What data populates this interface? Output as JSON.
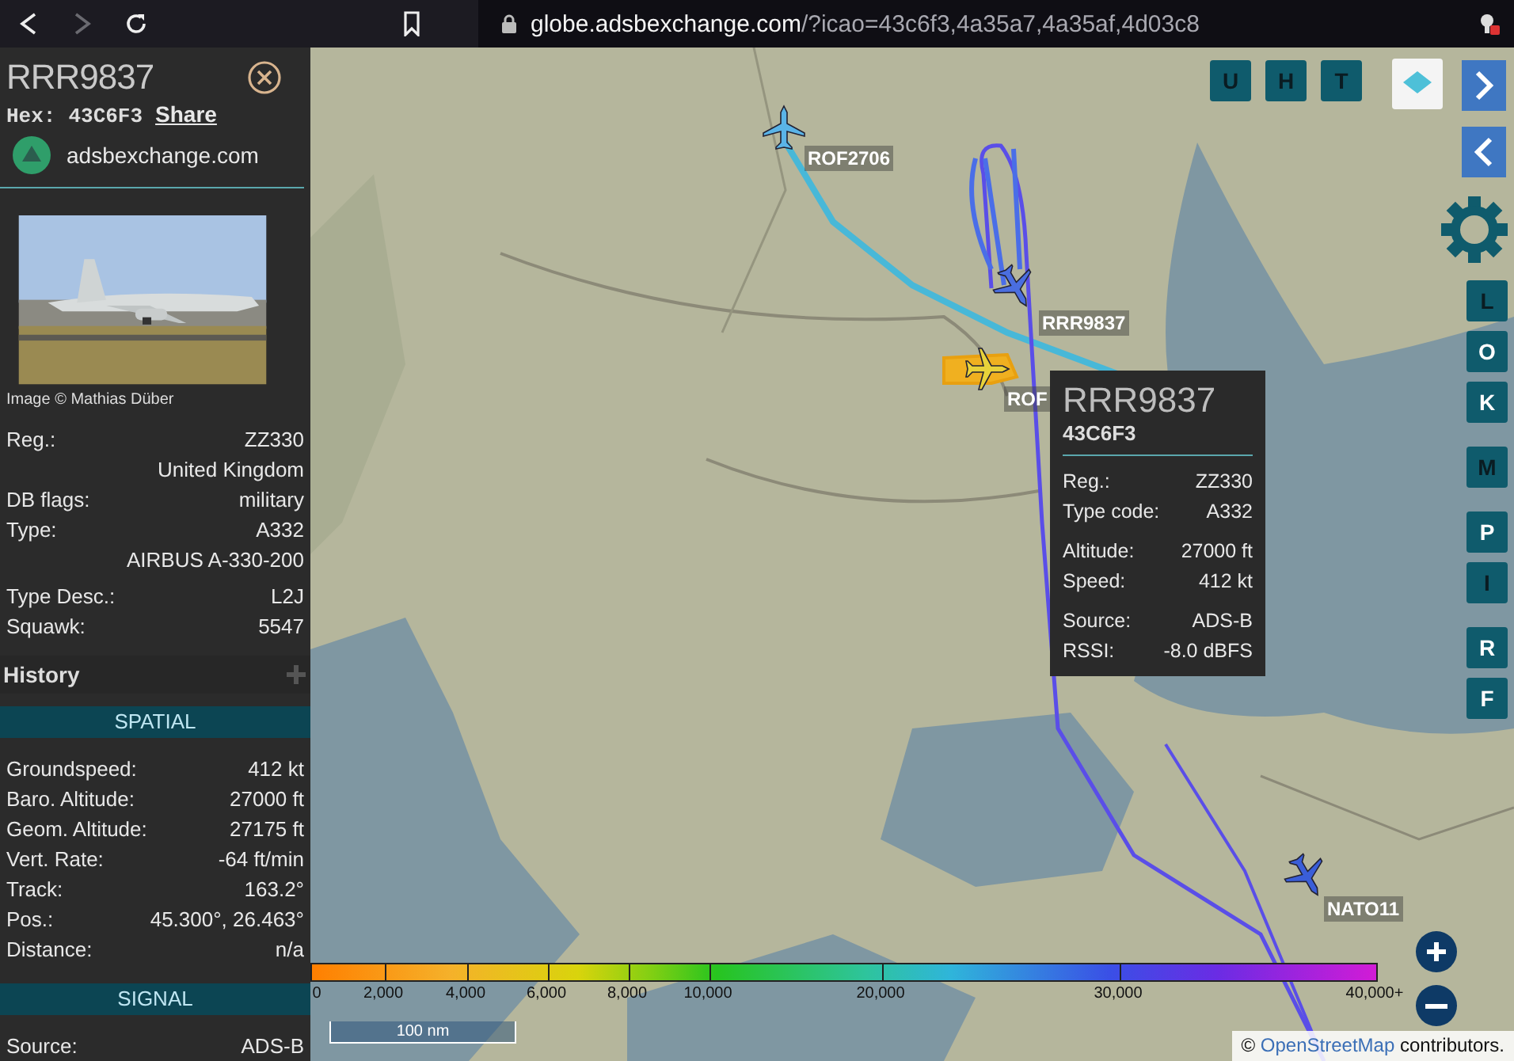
{
  "browser": {
    "url_host": "globe.adsbexchange.com",
    "url_path": "/?icao=43c6f3,4a35a7,4a35af,4d03c8",
    "forward_disabled": true
  },
  "sidebar": {
    "callsign": "RRR9837",
    "hex_label": "Hex:",
    "hex": "43C6F3",
    "share": "Share",
    "site": "adsbexchange.com",
    "photo_credit": "Image © Mathias Düber",
    "details": [
      {
        "label": "Reg.:",
        "value": "ZZ330"
      },
      {
        "value": "United Kingdom"
      },
      {
        "label": "DB flags:",
        "value": "military"
      },
      {
        "label": "Type:",
        "value": "A332"
      },
      {
        "value": "AIRBUS A-330-200"
      },
      {
        "label": "Type Desc.:",
        "value": "L2J"
      },
      {
        "label": "Squawk:",
        "value": "5547"
      }
    ],
    "history": "History",
    "sections": [
      {
        "title": "SPATIAL",
        "rows": [
          {
            "label": "Groundspeed:",
            "value": "412 kt"
          },
          {
            "label": "Baro. Altitude:",
            "value": "27000 ft"
          },
          {
            "label": "Geom. Altitude:",
            "value": "27175 ft"
          },
          {
            "label": "Vert. Rate:",
            "value": "-64 ft/min"
          },
          {
            "label": "Track:",
            "value": "163.2°"
          },
          {
            "label": "Pos.:",
            "value": "45.300°, 26.463°"
          },
          {
            "label": "Distance:",
            "value": "n/a"
          }
        ]
      },
      {
        "title": "SIGNAL",
        "rows": [
          {
            "label": "Source:",
            "value": "ADS-B"
          }
        ]
      }
    ]
  },
  "map": {
    "top_buttons": [
      {
        "label": "U",
        "active": true
      },
      {
        "label": "H",
        "active": true
      },
      {
        "label": "T",
        "active": true
      }
    ],
    "side_buttons": [
      {
        "label": "L",
        "active": true
      },
      {
        "label": "O",
        "active": false
      },
      {
        "label": "K",
        "active": false
      },
      {
        "label": "M",
        "active": true
      },
      {
        "label": "P",
        "active": false
      },
      {
        "label": "I",
        "active": true
      },
      {
        "label": "R",
        "active": false
      },
      {
        "label": "F",
        "active": false
      }
    ],
    "aircraft": [
      {
        "callsign": "ROF2706",
        "color": "#5ab4e8"
      },
      {
        "callsign": "RRR9837",
        "color": "#4a6ee0"
      },
      {
        "callsign": "ROF",
        "color": "#e8d23a"
      },
      {
        "callsign": "NATO11",
        "color": "#3a5ed8"
      }
    ],
    "tooltip": {
      "callsign": "RRR9837",
      "hex": "43C6F3",
      "groups": [
        [
          {
            "label": "Reg.:",
            "value": "ZZ330"
          },
          {
            "label": "Type code:",
            "value": "A332"
          }
        ],
        [
          {
            "label": "Altitude:",
            "value": "27000 ft"
          },
          {
            "label": "Speed:",
            "value": "412 kt"
          }
        ],
        [
          {
            "label": "Source:",
            "value": "ADS-B"
          },
          {
            "label": "RSSI:",
            "value": "-8.0 dBFS"
          }
        ]
      ]
    },
    "legend": [
      "0",
      "2,000",
      "4,000",
      "6,000",
      "8,000",
      "10,000",
      "20,000",
      "30,000",
      "40,000+"
    ],
    "scale": "100 nm",
    "attribution": {
      "prefix": "©",
      "link": "OpenStreetMap",
      "suffix": "contributors."
    }
  }
}
